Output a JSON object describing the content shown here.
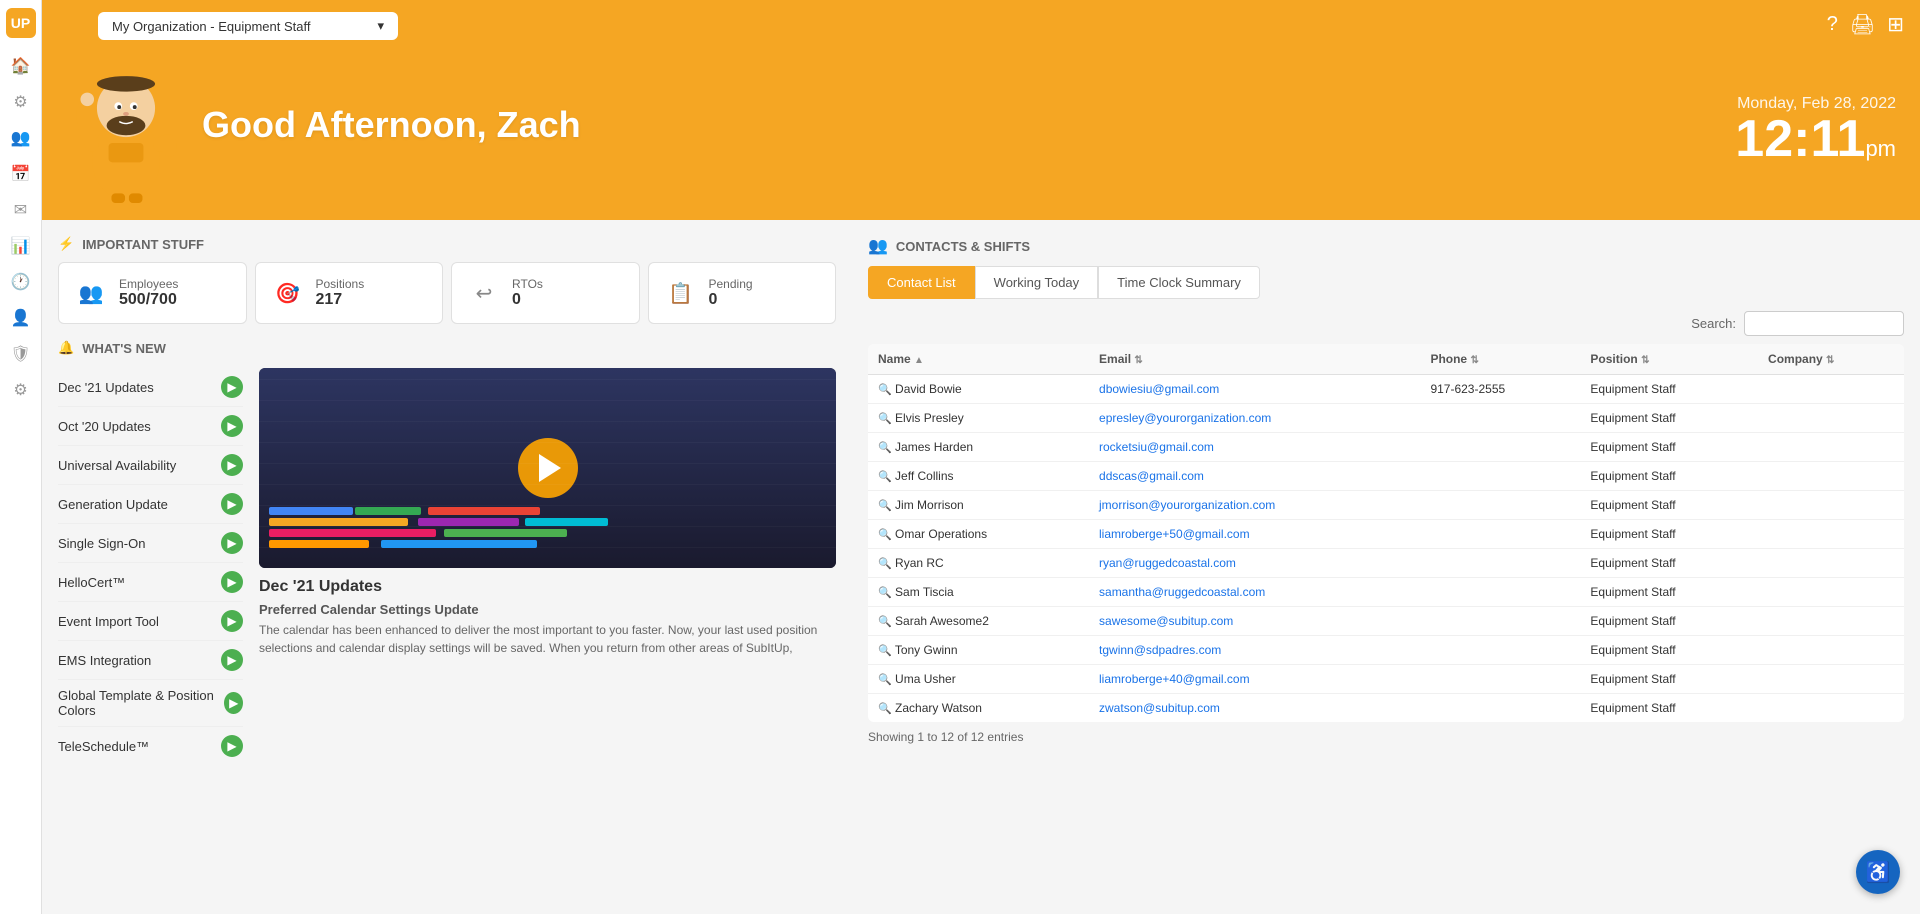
{
  "app": {
    "logo": "UP",
    "org_selector": {
      "label": "My Organization - Equipment Staff",
      "chevron": "▾"
    },
    "top_icons": [
      "?",
      "🖨",
      "⊞"
    ]
  },
  "header": {
    "greeting": "Good Afternoon, Zach",
    "date": "Monday, Feb 28, 2022",
    "time": "12:11",
    "time_suffix": "pm"
  },
  "sidebar": {
    "icons": [
      {
        "name": "settings",
        "symbol": "⚙",
        "active": false
      },
      {
        "name": "home",
        "symbol": "🏠",
        "active": true
      },
      {
        "name": "people",
        "symbol": "👥",
        "active": false
      },
      {
        "name": "calendar",
        "symbol": "📅",
        "active": false
      },
      {
        "name": "mail",
        "symbol": "✉",
        "active": false
      },
      {
        "name": "chart",
        "symbol": "📊",
        "active": false
      },
      {
        "name": "clock",
        "symbol": "🕐",
        "active": false
      },
      {
        "name": "user",
        "symbol": "👤",
        "active": false
      },
      {
        "name": "shield",
        "symbol": "🛡",
        "active": false
      },
      {
        "name": "settings2",
        "symbol": "⚙",
        "active": false
      }
    ]
  },
  "important_stuff": {
    "title": "IMPORTANT STUFF",
    "stats": [
      {
        "label": "Employees",
        "value": "500/700",
        "icon": "👥"
      },
      {
        "label": "Positions",
        "value": "217",
        "icon": "🎯"
      },
      {
        "label": "RTOs",
        "value": "0",
        "icon": "↩"
      },
      {
        "label": "Pending",
        "value": "0",
        "icon": "📋"
      }
    ]
  },
  "whats_new": {
    "title": "WHAT'S NEW",
    "items": [
      {
        "label": "Dec '21 Updates",
        "has_arrow": true
      },
      {
        "label": "Oct '20 Updates",
        "has_arrow": true
      },
      {
        "label": "Universal Availability",
        "has_arrow": true
      },
      {
        "label": "Generation Update",
        "has_arrow": true
      },
      {
        "label": "Single Sign-On",
        "has_arrow": true
      },
      {
        "label": "HelloCert™",
        "has_arrow": true
      },
      {
        "label": "Event Import Tool",
        "has_arrow": true
      },
      {
        "label": "EMS Integration",
        "has_arrow": true
      },
      {
        "label": "Global Template & Position Colors",
        "has_arrow": true
      },
      {
        "label": "TeleSchedule™",
        "has_arrow": true
      }
    ]
  },
  "video": {
    "title": "Dec '21 Updates",
    "subtitle": "Preferred Calendar Settings Update",
    "description": "The calendar has been enhanced to deliver the most important to you faster. Now, your last used position selections and calendar display settings will be saved. When you return from other areas of SubItUp,"
  },
  "contacts": {
    "section_title": "CONTACTS & SHIFTS",
    "tabs": [
      {
        "label": "Contact List",
        "active": true
      },
      {
        "label": "Working Today",
        "active": false
      },
      {
        "label": "Time Clock Summary",
        "active": false
      }
    ],
    "search_label": "Search:",
    "table": {
      "columns": [
        "Name",
        "Email",
        "Phone",
        "Position",
        "Company"
      ],
      "rows": [
        {
          "name": "David Bowie",
          "email": "dbowiesiu@gmail.com",
          "phone": "917-623-2555",
          "position": "Equipment Staff",
          "company": ""
        },
        {
          "name": "Elvis Presley",
          "email": "epresley@yourorganization.com",
          "phone": "",
          "position": "Equipment Staff",
          "company": ""
        },
        {
          "name": "James Harden",
          "email": "rocketsiu@gmail.com",
          "phone": "",
          "position": "Equipment Staff",
          "company": ""
        },
        {
          "name": "Jeff Collins",
          "email": "ddscas@gmail.com",
          "phone": "",
          "position": "Equipment Staff",
          "company": ""
        },
        {
          "name": "Jim Morrison",
          "email": "jmorrison@yourorganization.com",
          "phone": "",
          "position": "Equipment Staff",
          "company": ""
        },
        {
          "name": "Omar Operations",
          "email": "liamroberge+50@gmail.com",
          "phone": "",
          "position": "Equipment Staff",
          "company": ""
        },
        {
          "name": "Ryan RC",
          "email": "ryan@ruggedcoastal.com",
          "phone": "",
          "position": "Equipment Staff",
          "company": ""
        },
        {
          "name": "Sam Tiscia",
          "email": "samantha@ruggedcoastal.com",
          "phone": "",
          "position": "Equipment Staff",
          "company": ""
        },
        {
          "name": "Sarah Awesome2",
          "email": "sawesome@subitup.com",
          "phone": "",
          "position": "Equipment Staff",
          "company": ""
        },
        {
          "name": "Tony Gwinn",
          "email": "tgwinn@sdpadres.com",
          "phone": "",
          "position": "Equipment Staff",
          "company": ""
        },
        {
          "name": "Uma Usher",
          "email": "liamroberge+40@gmail.com",
          "phone": "",
          "position": "Equipment Staff",
          "company": ""
        },
        {
          "name": "Zachary Watson",
          "email": "zwatson@subitup.com",
          "phone": "",
          "position": "Equipment Staff",
          "company": ""
        }
      ],
      "footer": "Showing 1 to 12 of 12 entries"
    }
  },
  "accessibility": {
    "icon": "♿"
  }
}
